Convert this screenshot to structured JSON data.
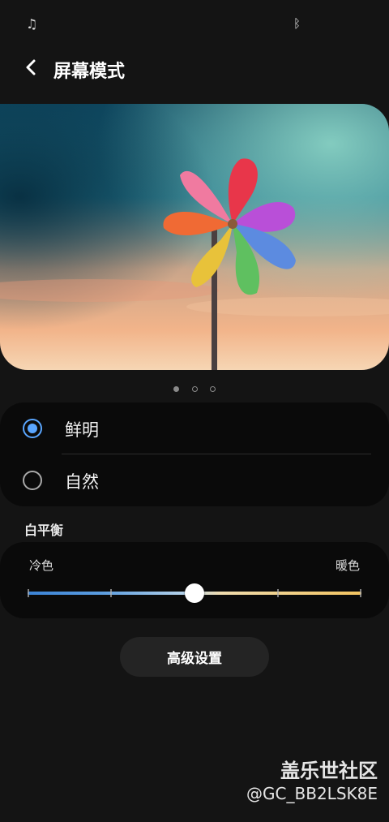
{
  "status_bar": {
    "left_icon": "music-note-icon",
    "right_icon": "bluetooth-icon"
  },
  "header": {
    "title": "屏幕模式",
    "back_icon": "back-chevron-icon"
  },
  "preview": {
    "image": "pinwheel-photo",
    "pages": 3,
    "active_page": 1
  },
  "screen_mode": {
    "options": [
      {
        "label": "鲜明",
        "selected": true
      },
      {
        "label": "自然",
        "selected": false
      }
    ]
  },
  "white_balance": {
    "title": "白平衡",
    "cold_label": "冷色",
    "warm_label": "暖色",
    "value": 0.5,
    "colors": {
      "cold": "#3b83d6",
      "warm": "#f3c460"
    }
  },
  "advanced_button": {
    "label": "高级设置"
  },
  "watermark": {
    "line1": "盖乐世社区",
    "line2": "@GC_BB2LSK8E"
  },
  "colors": {
    "accent": "#5aa6ff",
    "background": "#141414",
    "card": "#0a0a0a"
  }
}
